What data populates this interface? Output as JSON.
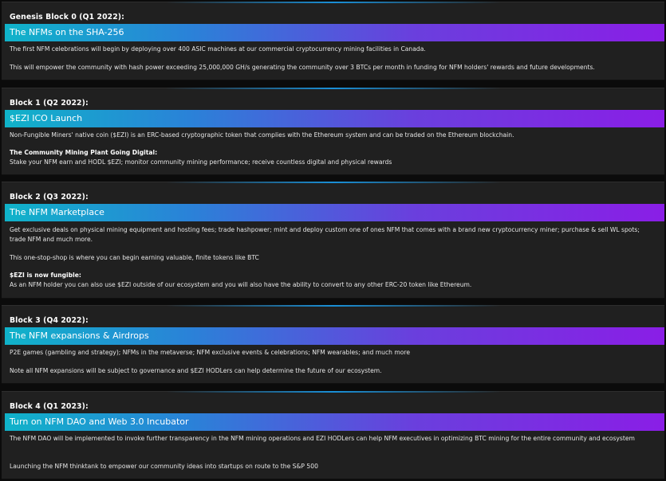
{
  "blocks": [
    {
      "title": "Genesis Block 0 (Q1 2022):",
      "banner": "The NFMs on the SHA-256",
      "paragraphs": [
        "The first NFM celebrations will begin by deploying over 400 ASIC machines at our commercial cryptocurrency mining facilities in Canada.",
        "This will empower the community with hash power exceeding 25,000,000 GH/s generating the community over 3 BTCs per month in funding for NFM holders' rewards and future developments."
      ]
    },
    {
      "title": "Block 1 (Q2 2022):",
      "banner": "$EZI ICO Launch",
      "paragraphs": [
        "Non-Fungible Miners' native coin ($EZI) is an ERC-based cryptographic token that complies with the Ethereum system and can be traded on the Ethereum blockchain.",
        "The Community Mining Plant Going Digital:",
        "Stake your NFM earn and HODL $EZI; monitor community mining performance; receive countless digital and physical rewards"
      ]
    },
    {
      "title": "Block 2 (Q3 2022):",
      "banner": "The NFM Marketplace",
      "paragraphs": [
        "Get exclusive deals on physical mining equipment and hosting fees; trade hashpower; mint and deploy custom one of ones NFM that comes with a brand new cryptocurrency miner; purchase & sell WL spots; trade NFM and much more.",
        "This one-stop-shop is where you can begin earning valuable, finite tokens like BTC",
        "$EZI is now fungible:",
        "As an NFM holder you can also use $EZI outside of our ecosystem and you will also have the ability to convert to any other ERC-20 token like Ethereum."
      ]
    },
    {
      "title": "Block 3 (Q4 2022):",
      "banner": "The NFM expansions & Airdrops",
      "paragraphs": [
        "P2E games (gambling and strategy); NFMs in the metaverse; NFM exclusive events & celebrations; NFM wearables; and much more",
        "Note all NFM expansions will be subject to governance and $EZI HODLers can help determine the future of our ecosystem."
      ]
    },
    {
      "title": "Block 4 (Q1 2023):",
      "banner": "Turn on NFM DAO and Web 3.0 Incubator",
      "paragraphs": [
        "The NFM DAO will be implemented to invoke further transparency in the NFM mining operations and EZI HODLers can help NFM executives in optimizing BTC mining for the entire community and ecosystem",
        "Launching the NFM thinktank to empower our community ideas into startups on route to the S&P 500"
      ]
    }
  ]
}
